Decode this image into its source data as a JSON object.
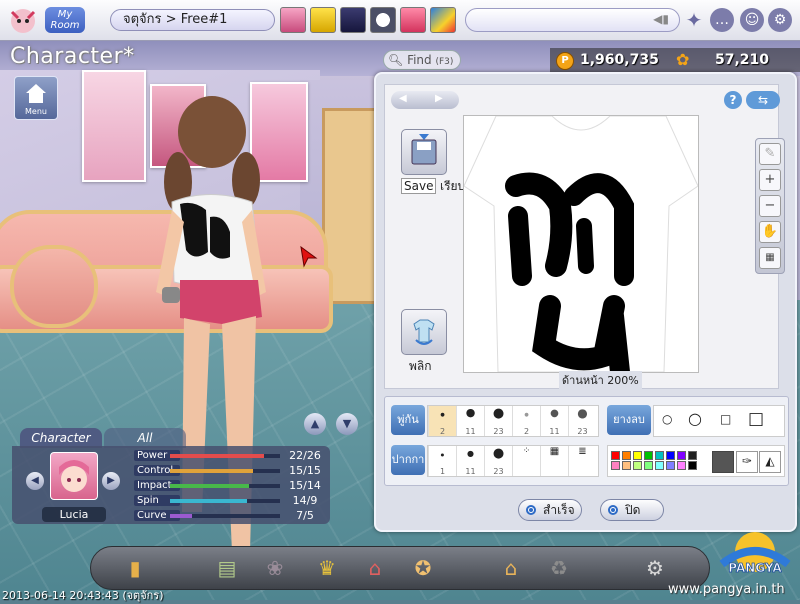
{
  "topbar": {
    "myroom_label": "My Room",
    "breadcrumb": "จตุจักร > Free#1",
    "chat_placeholder": ""
  },
  "header": {
    "title": "Character*",
    "menu_label": "Menu",
    "find_label": "Find",
    "find_shortcut": "(F3)",
    "pang_amount": "1,960,735",
    "cookie_amount": "57,210"
  },
  "editor": {
    "save_label": "Save",
    "save_status": "เรียบร้อย",
    "flip_label": "พลิก",
    "zoom_label": "ด้านหน้า 200%",
    "brush_tag": "พู่กัน",
    "eraser_tag": "ยางลบ",
    "stamp_tag": "ปากกา",
    "brush_sizes": [
      "2",
      "11",
      "23",
      "2",
      "11",
      "23"
    ],
    "stamp_sizes": [
      "1",
      "11",
      "23"
    ],
    "done_label": "สำเร็จ",
    "close_label": "ปิด",
    "palette": [
      "#ff0000",
      "#ff7f00",
      "#ffff00",
      "#00c000",
      "#00c0c0",
      "#0000ff",
      "#8000ff",
      "#202020",
      "#ff80c0",
      "#ffc080",
      "#c0ff80",
      "#80ff80",
      "#80ffff",
      "#8080ff",
      "#ff80ff",
      "#000000"
    ],
    "current_color": "#555555"
  },
  "character_panel": {
    "tab_character": "Character",
    "tab_all": "All",
    "name": "Lucia",
    "stats": [
      {
        "label": "Power",
        "value": "22/26",
        "fill": 0.85,
        "color": "#e44c4c"
      },
      {
        "label": "Control",
        "value": "15/15",
        "fill": 0.75,
        "color": "#e0a23a"
      },
      {
        "label": "Impact",
        "value": "15/14",
        "fill": 0.72,
        "color": "#48b84a"
      },
      {
        "label": "Spin",
        "value": "14/9",
        "fill": 0.7,
        "color": "#3ab7d0"
      },
      {
        "label": "Curve",
        "value": "7/5",
        "fill": 0.2,
        "color": "#9b5ad0"
      }
    ]
  },
  "footer": {
    "timestamp": "2013-06-14 20:43:43 (จตุจักร)",
    "website": "www.pangya.in.th",
    "logo_text": "PANGYA"
  },
  "colors": {
    "accent": "#3f6fb4",
    "dialog_bg": "#dcdfe9"
  }
}
